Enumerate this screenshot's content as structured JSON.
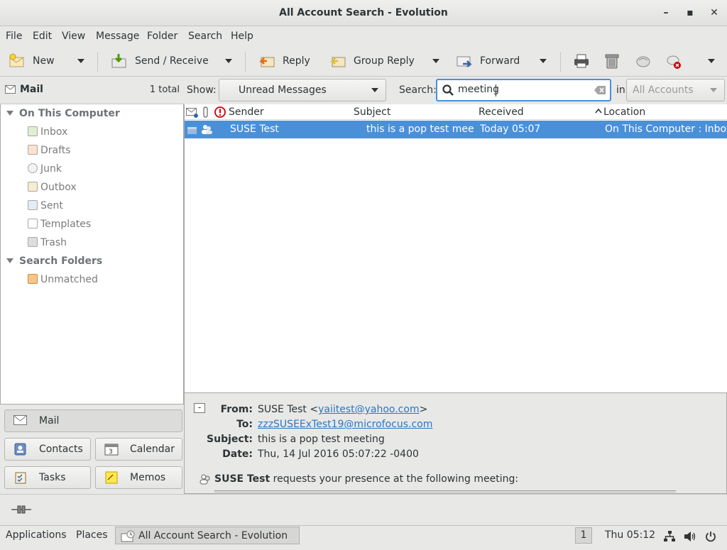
{
  "window": {
    "title": "All Account Search - Evolution",
    "minimize": "–",
    "maximize": "▪",
    "close": "✕"
  },
  "menu": [
    "File",
    "Edit",
    "View",
    "Message",
    "Folder",
    "Search",
    "Help"
  ],
  "toolbar": {
    "new": "New",
    "send_receive": "Send / Receive",
    "reply": "Reply",
    "group_reply": "Group Reply",
    "forward": "Forward"
  },
  "sidebar": {
    "title": "Mail",
    "total": "1 total",
    "groups": [
      {
        "label": "On This Computer",
        "items": [
          "Inbox",
          "Drafts",
          "Junk",
          "Outbox",
          "Sent",
          "Templates",
          "Trash"
        ]
      },
      {
        "label": "Search Folders",
        "items": [
          "Unmatched"
        ]
      }
    ]
  },
  "switcher": {
    "mail": "Mail",
    "contacts": "Contacts",
    "calendar": "Calendar",
    "tasks": "Tasks",
    "memos": "Memos"
  },
  "search": {
    "show_label": "Show:",
    "show_value": "Unread Messages",
    "search_label": "Search:",
    "query": "meeting",
    "in_label": "in",
    "scope": "All Accounts"
  },
  "columns": {
    "sender": "Sender",
    "subject": "Subject",
    "received": "Received",
    "location": "Location"
  },
  "messages": [
    {
      "sender": "SUSE Test",
      "subject": "this is a pop test mee…",
      "received": "Today 05:07",
      "location": "On This Computer : Inbox"
    }
  ],
  "preview": {
    "collapse": "-",
    "from_label": "From:",
    "from_name": "SUSE Test <",
    "from_email": "yaiitest@yahoo.com",
    "from_close": ">",
    "to_label": "To:",
    "to_email": "zzzSUSEExTest19@microfocus.com",
    "subject_label": "Subject:",
    "subject": "this is a pop test meeting",
    "date_label": "Date:",
    "date": "Thu, 14 Jul 2016 05:07:22 -0400",
    "invite_name": "SUSE Test",
    "invite_text": " requests your presence at the following meeting:"
  },
  "panel": {
    "applications": "Applications",
    "places": "Places",
    "task": "All Account Search - Evolution",
    "workspace": "1",
    "clock": "Thu 05:12"
  },
  "colors": {
    "selection": "#4a90d9",
    "link": "#2a76c6",
    "flag": "#cc0000"
  }
}
